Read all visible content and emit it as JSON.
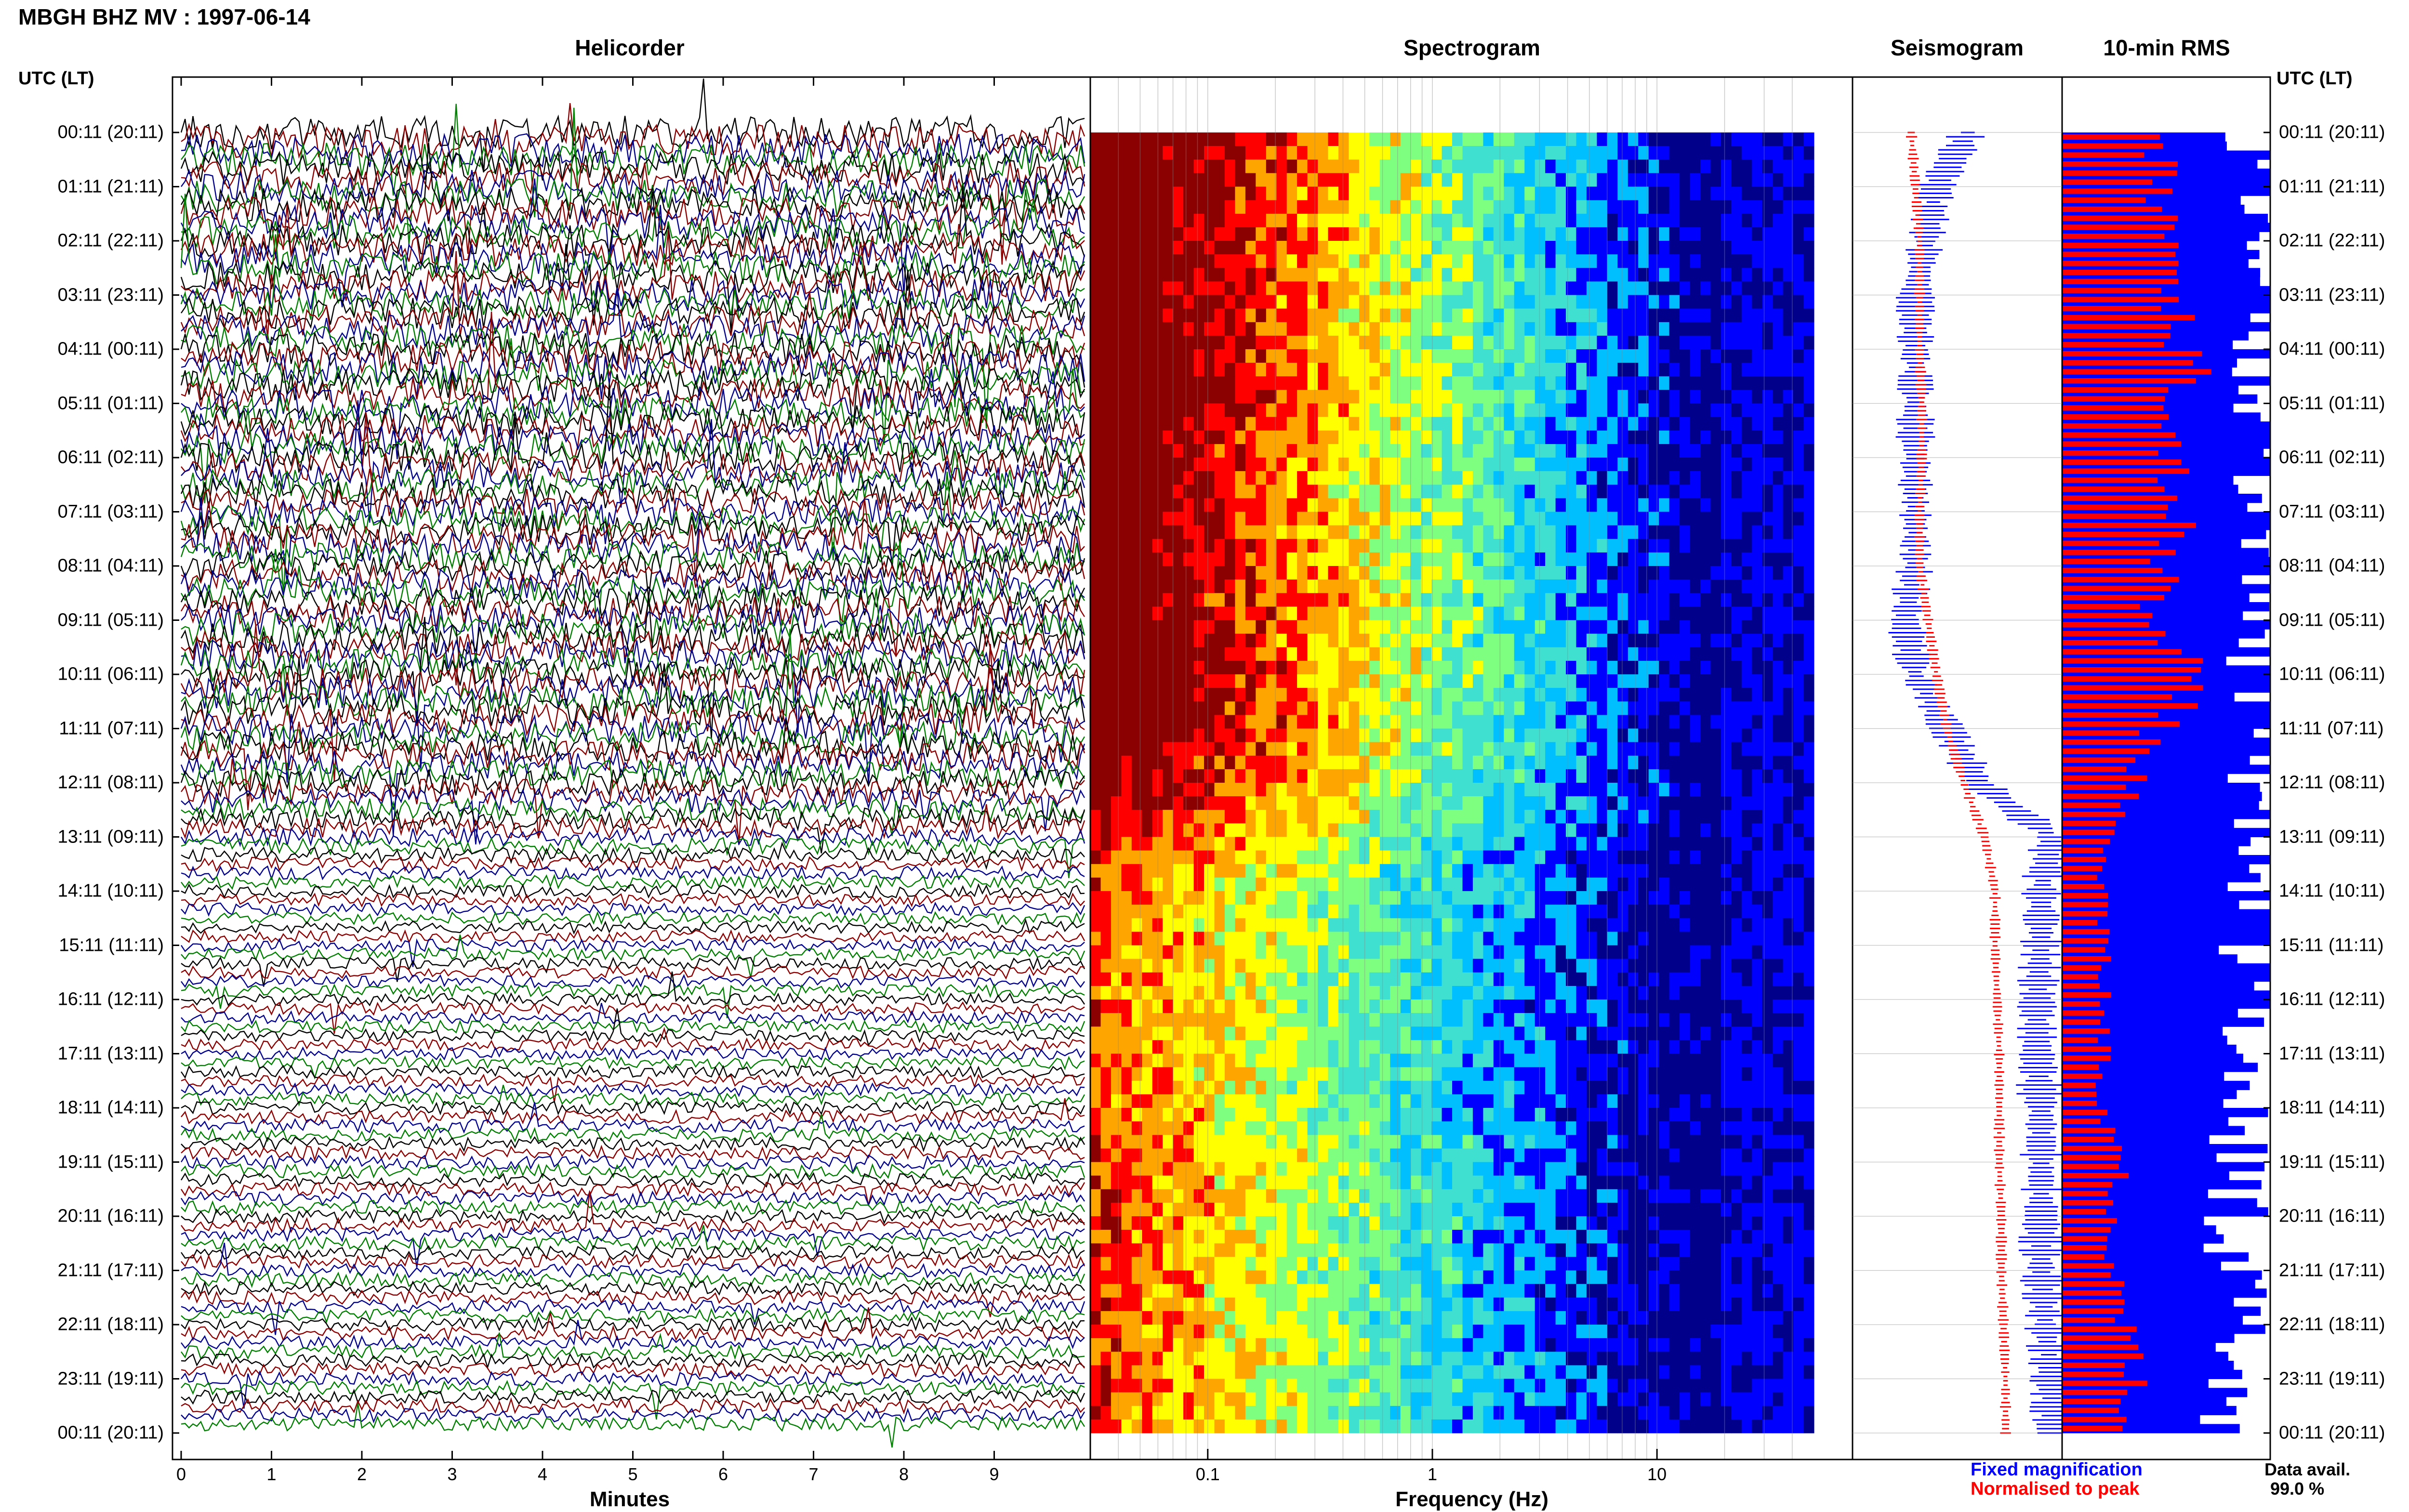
{
  "title": "MBGH BHZ MV : 1997-06-14",
  "panels": {
    "helicorder": "Helicorder",
    "spectrogram": "Spectrogram",
    "seismogram": "Seismogram",
    "rms": "10-min RMS"
  },
  "axis_header": "UTC (LT)",
  "time_labels": [
    "00:11 (20:11)",
    "01:11 (21:11)",
    "02:11 (22:11)",
    "03:11 (23:11)",
    "04:11 (00:11)",
    "05:11 (01:11)",
    "06:11 (02:11)",
    "07:11 (03:11)",
    "08:11 (04:11)",
    "09:11 (05:11)",
    "10:11 (06:11)",
    "11:11 (07:11)",
    "12:11 (08:11)",
    "13:11 (09:11)",
    "14:11 (10:11)",
    "15:11 (11:11)",
    "16:11 (12:11)",
    "17:11 (13:11)",
    "18:11 (14:11)",
    "19:11 (15:11)",
    "20:11 (16:11)",
    "21:11 (17:11)",
    "22:11 (18:11)",
    "23:11 (19:11)",
    "00:11 (20:11)"
  ],
  "x_labels": {
    "minutes": "Minutes",
    "frequency": "Frequency (Hz)"
  },
  "legend": {
    "fixed": "Fixed magnification",
    "normalised": "Normalised to peak"
  },
  "data_availability": {
    "label": "Data avail.",
    "value": "99.0 %"
  },
  "colors": {
    "fixed": "#0000ff",
    "normalised": "#ff0000",
    "trace_cycle": [
      "#000000",
      "#8b0000",
      "#00008b",
      "#007f00"
    ]
  },
  "chart_data": [
    {
      "type": "line",
      "title": "Helicorder",
      "xlabel": "Minutes",
      "x_ticks": [
        0,
        1,
        2,
        3,
        4,
        5,
        6,
        7,
        8,
        9
      ],
      "xlim": [
        0,
        10
      ],
      "rows": 144,
      "row_minutes": 10,
      "note_levels": "amplitude high 00:11-12:30 UTC, low thereafter",
      "amplitude_level": [
        0.9,
        0.9,
        0.9,
        0.85,
        0.9,
        0.9,
        0.8,
        0.8,
        0.85,
        0.85,
        0.9,
        0.8,
        0.6,
        0.3,
        0.25,
        0.25,
        0.25,
        0.25,
        0.3,
        0.3,
        0.3,
        0.3,
        0.3,
        0.3
      ]
    },
    {
      "type": "heatmap",
      "title": "Spectrogram",
      "xlabel": "Frequency (Hz)",
      "x_scale": "log",
      "x_ticks": [
        0.1,
        1,
        10
      ],
      "xlim": [
        0.03,
        50
      ],
      "colormap": [
        "#00008b",
        "#0000ff",
        "#00bfff",
        "#40e0d0",
        "#7fff7f",
        "#ffff00",
        "#ffa500",
        "#ff0000",
        "#8b0000"
      ]
    },
    {
      "type": "line",
      "title": "Seismogram",
      "series": [
        {
          "name": "Fixed magnification",
          "color": "#0000ff",
          "values": [
            0.55,
            0.4,
            0.35,
            0.3,
            0.3,
            0.3,
            0.3,
            0.3,
            0.3,
            0.25,
            0.3,
            0.45,
            0.6,
            0.95,
            0.9,
            0.9,
            0.88,
            0.88,
            0.9,
            0.9,
            0.9,
            0.9,
            0.92,
            0.95,
            0.95
          ]
        },
        {
          "name": "Normalised to peak",
          "color": "#ff0000",
          "values": [
            0.28,
            0.3,
            0.32,
            0.32,
            0.32,
            0.33,
            0.33,
            0.32,
            0.32,
            0.36,
            0.4,
            0.45,
            0.53,
            0.63,
            0.68,
            0.68,
            0.69,
            0.7,
            0.7,
            0.7,
            0.71,
            0.71,
            0.72,
            0.73,
            0.73
          ]
        }
      ]
    },
    {
      "type": "bar",
      "title": "10-min RMS",
      "series": [
        {
          "name": "Fixed magnification",
          "color": "#0000ff",
          "values": [
            0.98,
            0.97,
            0.98,
            0.97,
            0.97,
            0.97,
            0.97,
            0.98,
            0.98,
            0.98,
            0.98,
            0.98,
            0.98,
            0.95,
            0.92,
            0.9,
            0.92,
            0.9,
            0.85,
            0.85,
            0.85,
            0.84,
            0.85,
            0.83,
            0.8
          ]
        },
        {
          "name": "Normalised to peak",
          "color": "#ff0000",
          "values": [
            0.5,
            0.45,
            0.55,
            0.55,
            0.6,
            0.6,
            0.55,
            0.55,
            0.5,
            0.4,
            0.7,
            0.45,
            0.35,
            0.2,
            0.2,
            0.2,
            0.2,
            0.2,
            0.2,
            0.3,
            0.25,
            0.25,
            0.3,
            0.35,
            0.3
          ]
        }
      ]
    }
  ]
}
